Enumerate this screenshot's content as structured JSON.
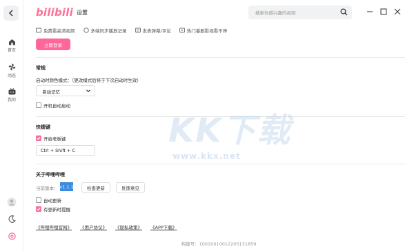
{
  "topbar": {
    "logo": "bilibili",
    "title": "设置",
    "search_placeholder": "搜索你感兴趣的视频"
  },
  "sidebar": {
    "items": [
      {
        "label": "首页",
        "icon": "home-icon"
      },
      {
        "label": "动态",
        "icon": "fan-icon"
      },
      {
        "label": "我的",
        "icon": "tv-icon"
      }
    ]
  },
  "account": {
    "benefits": [
      "免费看高清视频",
      "多端同步播放记录",
      "发表弹幕/评论",
      "热门番剧影视看不停"
    ],
    "login_label": "立即登录"
  },
  "general": {
    "title": "常规",
    "theme_label": "启动时颜色模式：（更改模式后将于下次启动时生效）",
    "theme_value": "自动记忆",
    "autostart_label": "开机自动启动",
    "autostart_checked": false
  },
  "shortcuts": {
    "title": "快捷键",
    "boss_key_label": "开启老板键",
    "boss_key_checked": true,
    "boss_key_value": "Ctrl + Shift + C"
  },
  "about": {
    "title": "关于哔哩哔哩",
    "version_label": "当前版本：",
    "version": "v1.1.1",
    "check_update": "检查更新",
    "feedback": "反馈意见",
    "auto_update_label": "自动更新",
    "auto_update_checked": false,
    "notify_label": "有更新时提醒",
    "notify_checked": true,
    "links": [
      "《哔哩哔哩官网》",
      "《用户协议》",
      "《隐私政策》",
      "《APP下载》"
    ],
    "build": "构建号：1001001001220513185​9"
  },
  "watermark": {
    "big": "KK下载",
    "small": "www.kkx.net"
  },
  "colors": {
    "brand_pink": "#fb7299",
    "login_pink": "#ff6699",
    "version_blue": "#3c8be0"
  }
}
